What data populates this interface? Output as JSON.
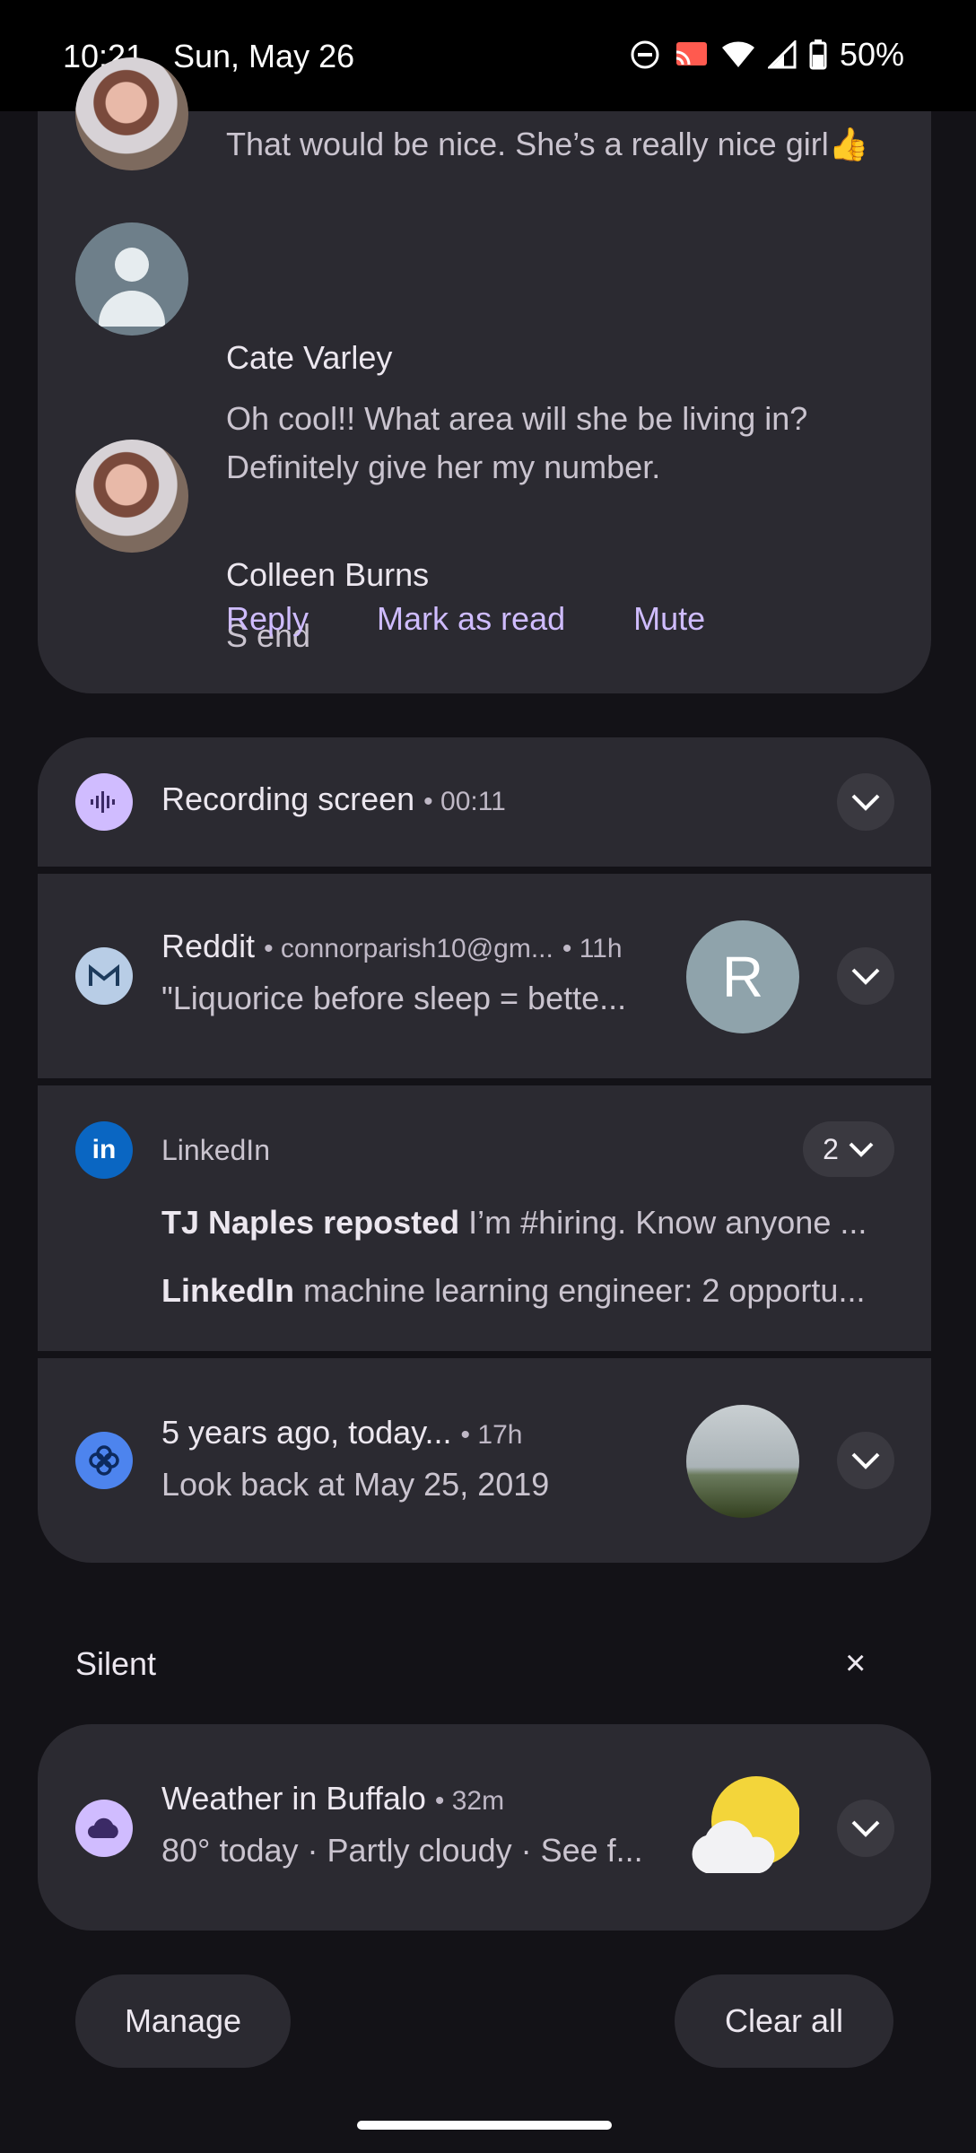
{
  "status_bar": {
    "time": "10:21",
    "date": "Sun, May 26",
    "battery": "50%",
    "icons": [
      "do-not-disturb-icon",
      "cast-icon",
      "wifi-icon",
      "signal-icon",
      "battery-icon"
    ]
  },
  "conversation": {
    "messages": [
      {
        "sender": "",
        "text": "That would be nice. She’s a really nice girl👍"
      },
      {
        "sender": "Cate Varley",
        "text_line1": "Oh cool!! What area will she be living in?",
        "text_line2": "Definitely give her my number."
      },
      {
        "sender": "Colleen Burns",
        "text": "S end"
      }
    ],
    "actions": {
      "reply": "Reply",
      "mark_as_read": "Mark as read",
      "mute": "Mute"
    }
  },
  "recording": {
    "title": "Recording screen",
    "time": "• 00:11",
    "icon": "sound-wave-icon"
  },
  "reddit": {
    "app": "Reddit",
    "account": "• connorparish10@gm...",
    "age": "• 11h",
    "preview": "\"Liquorice before sleep = bette...",
    "avatar_letter": "R",
    "icon": "mail-icon"
  },
  "linkedin": {
    "app": "LinkedIn",
    "count": "2",
    "lines": [
      {
        "bold": "TJ Naples reposted",
        "rest": "I’m #hiring. Know anyone ..."
      },
      {
        "bold": "LinkedIn",
        "rest": "machine learning engineer: 2 opportu..."
      }
    ],
    "icon": "linkedin-icon"
  },
  "memories": {
    "title": "5 years ago, today...",
    "age": "• 17h",
    "subtitle": "Look back at May 25, 2019",
    "icon": "pinwheel-icon"
  },
  "silent_section": {
    "label": "Silent",
    "close": "×"
  },
  "weather": {
    "title": "Weather in Buffalo",
    "age": "• 32m",
    "subtitle": "80° today · Partly cloudy · See f...",
    "icon": "cloud-icon"
  },
  "footer": {
    "manage": "Manage",
    "clear_all": "Clear all"
  },
  "colors": {
    "accent": "#cfbcff",
    "card": "#2b2a31",
    "background": "#131217"
  }
}
